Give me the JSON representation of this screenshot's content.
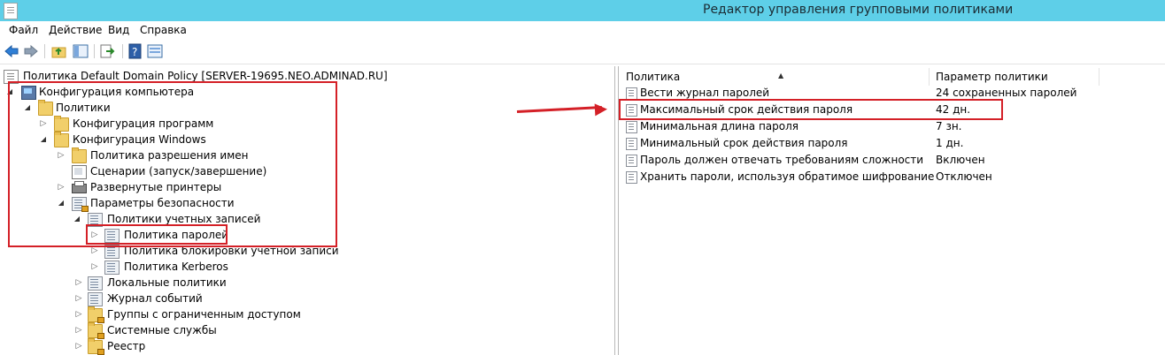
{
  "window": {
    "title": "Редактор управления групповыми политиками"
  },
  "menu": {
    "items": [
      "Файл",
      "Действие",
      "Вид",
      "Справка"
    ]
  },
  "toolbar": {
    "buttons": [
      "back-icon",
      "forward-icon",
      "up-folder-icon",
      "show-hide-tree-icon",
      "export-list-icon",
      "help-icon",
      "properties-icon"
    ]
  },
  "tree": {
    "root": "Политика Default Domain Policy [SERVER-19695.NEO.ADMINAD.RU]",
    "items": [
      {
        "label": "Конфигурация компьютера",
        "icon": "computer-icon",
        "expanded": true
      },
      {
        "label": "Политики",
        "icon": "folder-icon",
        "expanded": true
      },
      {
        "label": "Конфигурация программ",
        "icon": "folder-icon",
        "expanded": false
      },
      {
        "label": "Конфигурация Windows",
        "icon": "folder-icon",
        "expanded": true
      },
      {
        "label": "Политика разрешения имен",
        "icon": "folder-icon",
        "expanded": false
      },
      {
        "label": "Сценарии (запуск/завершение)",
        "icon": "script-icon",
        "expanded": null
      },
      {
        "label": "Развернутые принтеры",
        "icon": "printer-icon",
        "expanded": false
      },
      {
        "label": "Параметры безопасности",
        "icon": "security-icon",
        "expanded": true
      },
      {
        "label": "Политики учетных записей",
        "icon": "list-icon",
        "expanded": true
      },
      {
        "label": "Политика паролей",
        "icon": "list-icon",
        "expanded": false,
        "selected": true
      },
      {
        "label": "Политика блокировки учетной записи",
        "icon": "list-icon",
        "expanded": false
      },
      {
        "label": "Политика Kerberos",
        "icon": "list-icon",
        "expanded": false
      },
      {
        "label": "Локальные политики",
        "icon": "list-icon",
        "expanded": false
      },
      {
        "label": "Журнал событий",
        "icon": "list-icon",
        "expanded": false
      },
      {
        "label": "Группы с ограниченным доступом",
        "icon": "folder-lock-icon",
        "expanded": false
      },
      {
        "label": "Системные службы",
        "icon": "folder-lock-icon",
        "expanded": false
      },
      {
        "label": "Реестр",
        "icon": "folder-lock-icon",
        "expanded": false
      }
    ]
  },
  "list": {
    "columns": [
      "Политика",
      "Параметр политики"
    ],
    "rows": [
      {
        "name": "Вести журнал паролей",
        "value": "24 сохраненных паролей"
      },
      {
        "name": "Максимальный срок действия пароля",
        "value": "42 дн.",
        "highlighted": true
      },
      {
        "name": "Минимальная длина пароля",
        "value": "7 зн."
      },
      {
        "name": "Минимальный срок действия пароля",
        "value": "1 дн."
      },
      {
        "name": "Пароль должен отвечать требованиям сложности",
        "value": "Включен"
      },
      {
        "name": "Хранить пароли, используя обратимое шифрование",
        "value": "Отключен"
      }
    ]
  },
  "colors": {
    "titlebar": "#5ecfe8",
    "highlight": "#d42027"
  }
}
